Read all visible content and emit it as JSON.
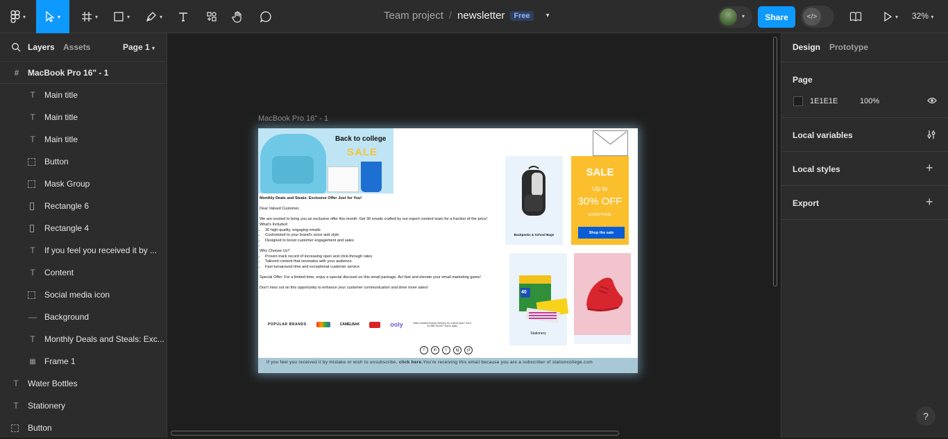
{
  "topbar": {
    "project": "Team project",
    "separator": "/",
    "file": "newsletter",
    "plan_badge": "Free",
    "share_label": "Share",
    "zoom": "32%"
  },
  "left_panel": {
    "tabs": {
      "layers": "Layers",
      "assets": "Assets",
      "page": "Page 1"
    },
    "frame_name": "MacBook Pro 16\" - 1",
    "layers": [
      {
        "icon": "text-icon",
        "label": "Main title"
      },
      {
        "icon": "text-icon",
        "label": "Main title"
      },
      {
        "icon": "text-icon",
        "label": "Main title"
      },
      {
        "icon": "group-icon",
        "label": "Button"
      },
      {
        "icon": "group-icon",
        "label": "Mask Group"
      },
      {
        "icon": "rectangle-icon",
        "label": "Rectangle 6"
      },
      {
        "icon": "rectangle-icon",
        "label": "Rectangle 4"
      },
      {
        "icon": "text-icon",
        "label": "If you feel you received it by ..."
      },
      {
        "icon": "text-icon",
        "label": "Content"
      },
      {
        "icon": "group-icon",
        "label": "Social media icon"
      },
      {
        "icon": "line-icon",
        "label": "Background"
      },
      {
        "icon": "text-icon",
        "label": "Monthly Deals and Steals: Exc..."
      },
      {
        "icon": "grid-icon",
        "label": "Frame 1"
      }
    ],
    "root_layers": [
      {
        "icon": "text-icon",
        "label": "Water Bottles"
      },
      {
        "icon": "text-icon",
        "label": "Stationery"
      },
      {
        "icon": "group-icon",
        "label": "Button"
      }
    ]
  },
  "canvas": {
    "frame_label": "MacBook Pro 16\" - 1",
    "hero": {
      "title": "Back to college",
      "sale": "SALE"
    },
    "body": {
      "headline": "Monthly Deals and Steals: Exclusive Offer Just for You!",
      "greeting": "Dear Valued Customer,",
      "intro": "We are excited to bring you an exclusive offer this month: Get 30 emails crafted by our expert content team for a fraction of the price!",
      "included_title": "What's Included:",
      "included": [
        "30 high-quality, engaging emails",
        "Customized to your brand's voice and style",
        "Designed to boost customer engagement and sales",
        ""
      ],
      "why_title": "Why Choose Us?",
      "why": [
        "Proven track record of increasing open and click-through rates",
        "Tailored content that resonates with your audience",
        "Fast turnaround time and exceptional customer service"
      ],
      "special": " Special Offer: For a limited time, enjoy a special discount on this email package. Act fast and elevate your email marketing game!",
      "closing": "Don't miss out on this opportunity to enhance your customer communication and drive more sales!"
    },
    "cards": {
      "backpack_caption": "Backpacks & School Bags",
      "sale_title": "SALE",
      "sale_upto": "Up to",
      "sale_percent": "30% OFF",
      "sale_everything": "EVERYTHING",
      "sale_button": "Shop the sale",
      "stationery_caption": "Stationery",
      "crayola_count": "40"
    },
    "brands": {
      "label": "POPULAR BRANDS",
      "camelbak": "CAMELBAK",
      "ooly": "ooly",
      "promo": "Want a limited Express Delivery for a whole year? Get it for A$9 SALE8 *Ts&Cs apply"
    },
    "social_icons": [
      "f",
      "in",
      "t",
      "ig",
      "yt"
    ],
    "footer": {
      "text_before": "If you feel you received it by mistake or wish to unsubscribe, ",
      "link": "click here.",
      "text_after": "You're receiving this email because you are a subscriber of stationcollege.com"
    }
  },
  "right_panel": {
    "tabs": {
      "design": "Design",
      "prototype": "Prototype"
    },
    "page_title": "Page",
    "page_color": "1E1E1E",
    "page_opacity": "100%",
    "sections": [
      "Local variables",
      "Local styles",
      "Export"
    ]
  },
  "colors": {
    "accent": "#0d99ff",
    "sale_card": "#fbbf2e",
    "shop_button": "#0a5dd6",
    "footer": "#a9c8d6"
  }
}
